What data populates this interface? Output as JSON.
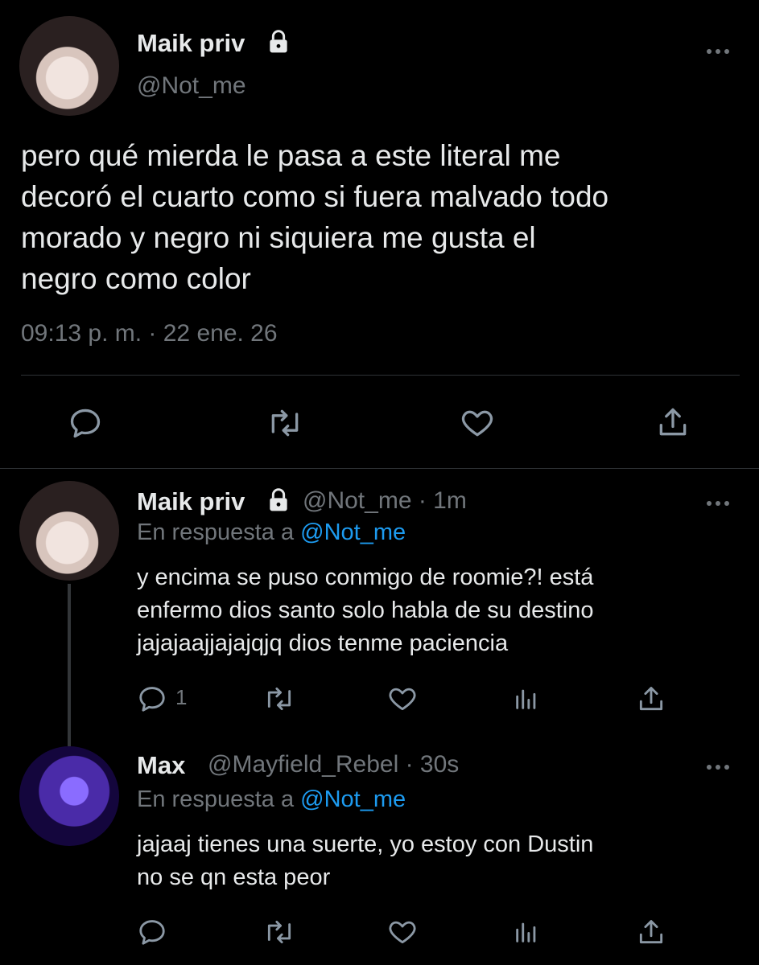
{
  "main_tweet": {
    "display_name": "Maik priv",
    "handle": "@Not_me",
    "text_lines": [
      "pero qué mierda le pasa a este literal me",
      "decoró el cuarto como si fuera malvado todo",
      "morado y negro ni siquiera me gusta el",
      "negro como color"
    ],
    "timestamp": "09:13 p. m. · 22 ene. 26"
  },
  "reply1": {
    "display_name": "Maik priv",
    "handle_time": "@Not_me · 1m",
    "reply_prefix": "En respuesta a",
    "reply_to": "@Not_me",
    "text_lines": [
      "y encima se puso conmigo de roomie?! está",
      "enfermo dios santo solo habla de su destino",
      "jajajaajjajajqjq dios tenme paciencia"
    ],
    "reply_count": "1"
  },
  "reply2": {
    "display_name": "Max",
    "handle_time": "@Mayfield_Rebel · 30s",
    "reply_prefix": "En respuesta a",
    "reply_to": "@Not_me",
    "text_lines": [
      "jajaaj tienes una suerte, yo estoy con Dustin",
      "no se qn esta peor"
    ]
  },
  "icons": [
    "lock-icon",
    "more-icon",
    "reply-icon",
    "retweet-icon",
    "like-icon",
    "share-icon",
    "analytics-icon"
  ],
  "colors": {
    "background": "#000000",
    "text": "#e7e9ea",
    "secondary": "#71767b",
    "link": "#1d9bf0"
  }
}
